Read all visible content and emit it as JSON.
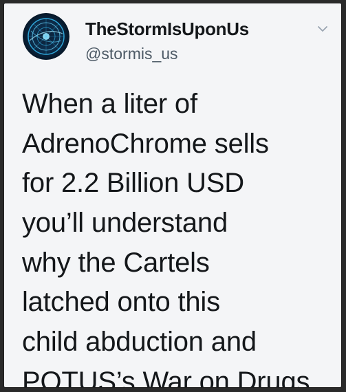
{
  "tweet": {
    "author": {
      "display_name": "TheStormIsUponUs",
      "handle": "@stormis_us",
      "avatar_icon": "storm-avatar-icon"
    },
    "menu_icon": "chevron-down-icon",
    "text_lines": [
      "When a liter of",
      "AdrenoChrome sells",
      "for 2.2 Billion USD",
      "you’ll understand",
      "why the Cartels",
      "latched onto this",
      "child abduction and",
      "POTUS’s War on Drugs."
    ]
  },
  "colors": {
    "background": "#f4f5f7",
    "text": "#14171a",
    "secondary_text": "#4d5a66",
    "avatar_glow": "#38c6ff",
    "frame": "#2a2a2a"
  }
}
